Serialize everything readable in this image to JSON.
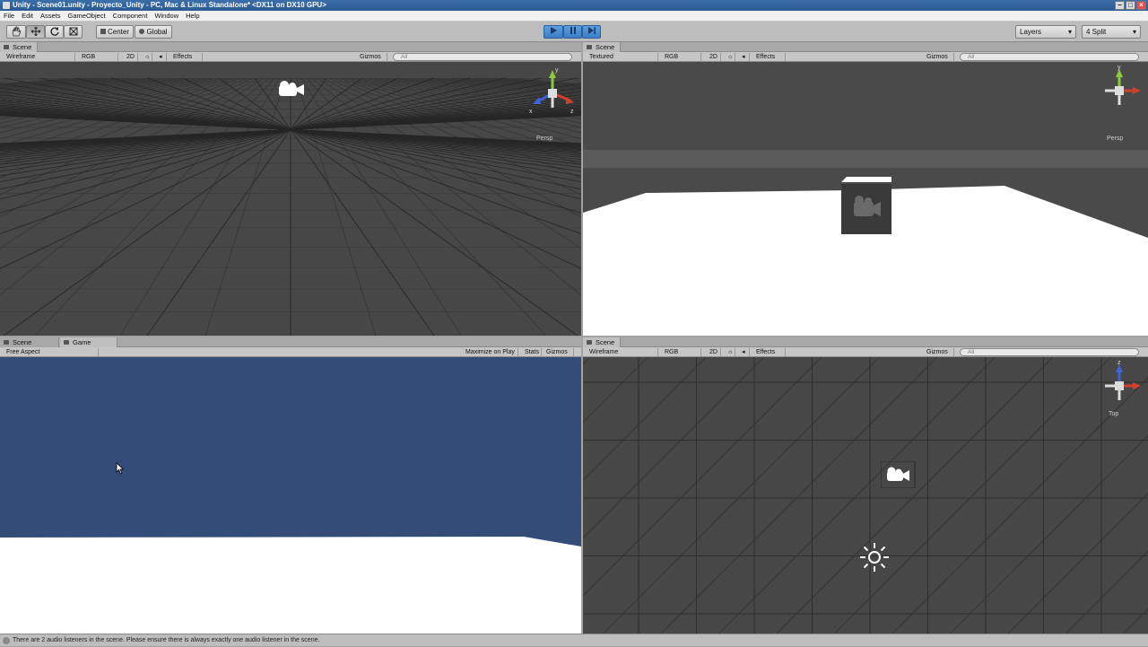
{
  "window": {
    "title": "Unity - Scene01.unity - Proyecto_Unity - PC, Mac & Linux Standalone* <DX11 on DX10 GPU>",
    "min": "–",
    "max": "□",
    "close": "×"
  },
  "menu": [
    "File",
    "Edit",
    "Assets",
    "GameObject",
    "Component",
    "Window",
    "Help"
  ],
  "toolbar": {
    "tools": [
      "hand-icon",
      "move-icon",
      "rotate-icon",
      "scale-icon"
    ],
    "pivot": "Center",
    "space": "Global",
    "play": "play-icon",
    "pause": "pause-icon",
    "step": "step-icon",
    "layers": "Layers",
    "layout": "4 Split"
  },
  "panes": {
    "top_left": {
      "tab": "Scene",
      "render_mode": "Wireframe",
      "color_mode": "RGB",
      "mode2d": "2D",
      "effects": "Effects",
      "gizmos": "Gizmos",
      "search": "All",
      "projection": "Persp"
    },
    "top_right": {
      "tab": "Scene",
      "render_mode": "Textured",
      "color_mode": "RGB",
      "mode2d": "2D",
      "effects": "Effects",
      "gizmos": "Gizmos",
      "search": "All",
      "projection": "Persp"
    },
    "bottom_left": {
      "tab_scene": "Scene",
      "tab_game": "Game",
      "aspect": "Free Aspect",
      "maximize": "Maximize on Play",
      "stats": "Stats",
      "gizmos": "Gizmos"
    },
    "bottom_right": {
      "tab": "Scene",
      "render_mode": "Wireframe",
      "color_mode": "RGB",
      "mode2d": "2D",
      "effects": "Effects",
      "gizmos": "Gizmos",
      "search": "All",
      "projection": "Top"
    }
  },
  "gizmo_axes": {
    "x": "x",
    "y": "y",
    "z": "z"
  },
  "status": "There are 2 audio listeners in the scene. Please ensure there is always exactly one audio listener in the scene.",
  "colors": {
    "scene_bg": "#464646",
    "game_sky": "#344c78",
    "grid": "#2f2f2f",
    "x_axis": "#d2402c",
    "y_axis": "#8cc83c",
    "z_axis": "#3c64d2"
  }
}
